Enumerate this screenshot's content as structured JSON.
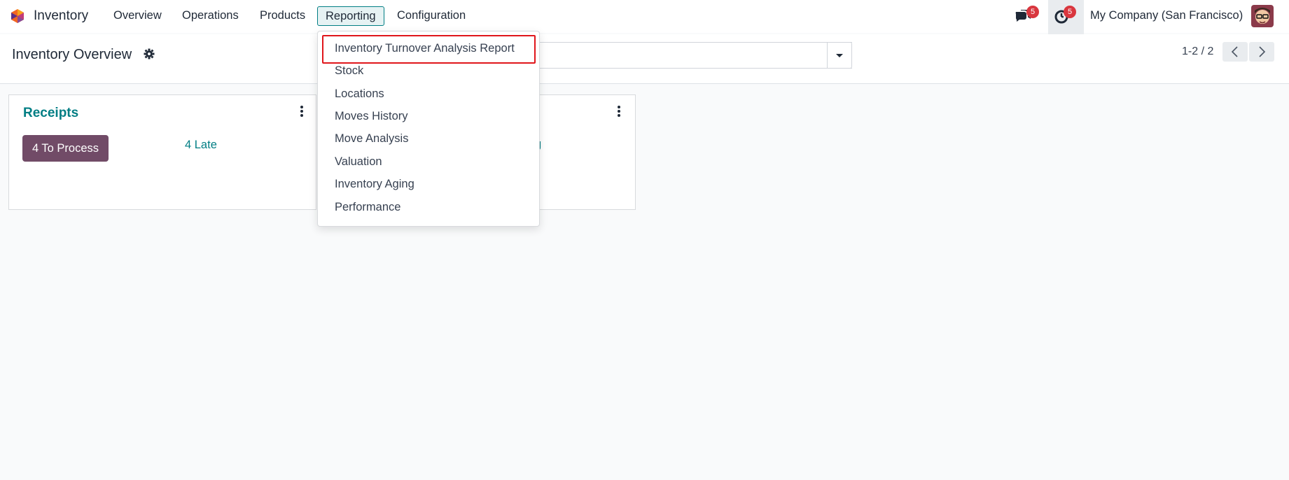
{
  "navbar": {
    "app_name": "Inventory",
    "menu": [
      "Overview",
      "Operations",
      "Products",
      "Reporting",
      "Configuration"
    ],
    "active_menu": "Reporting",
    "messages_badge": "5",
    "activities_badge": "5",
    "company": "My Company (San Francisco)"
  },
  "control_panel": {
    "breadcrumb": "Inventory Overview",
    "pager": "1-2 / 2"
  },
  "cards": [
    {
      "title": "Receipts",
      "primary_button": "4 To Process",
      "late_link": "4 Late"
    },
    {
      "partial_link": "g"
    }
  ],
  "reporting_dropdown": {
    "items": [
      "Inventory Turnover Analysis Report",
      "Stock",
      "Locations",
      "Moves History",
      "Move Analysis",
      "Valuation",
      "Inventory Aging",
      "Performance"
    ],
    "highlighted_item": "Inventory Turnover Analysis Report"
  },
  "colors": {
    "accent": "#017e84",
    "primary_button": "#714b67",
    "badge": "#d9363e",
    "highlight_box": "#e0161b"
  },
  "icons": {
    "app_logo": "odoo-inventory-logo",
    "messages": "chat-bubbles-icon",
    "activities": "clock-icon",
    "settings": "gear-icon",
    "search_toggle": "caret-down-icon",
    "pager_prev": "chevron-left-icon",
    "pager_next": "chevron-right-icon",
    "card_menu": "kebab-menu-icon"
  }
}
